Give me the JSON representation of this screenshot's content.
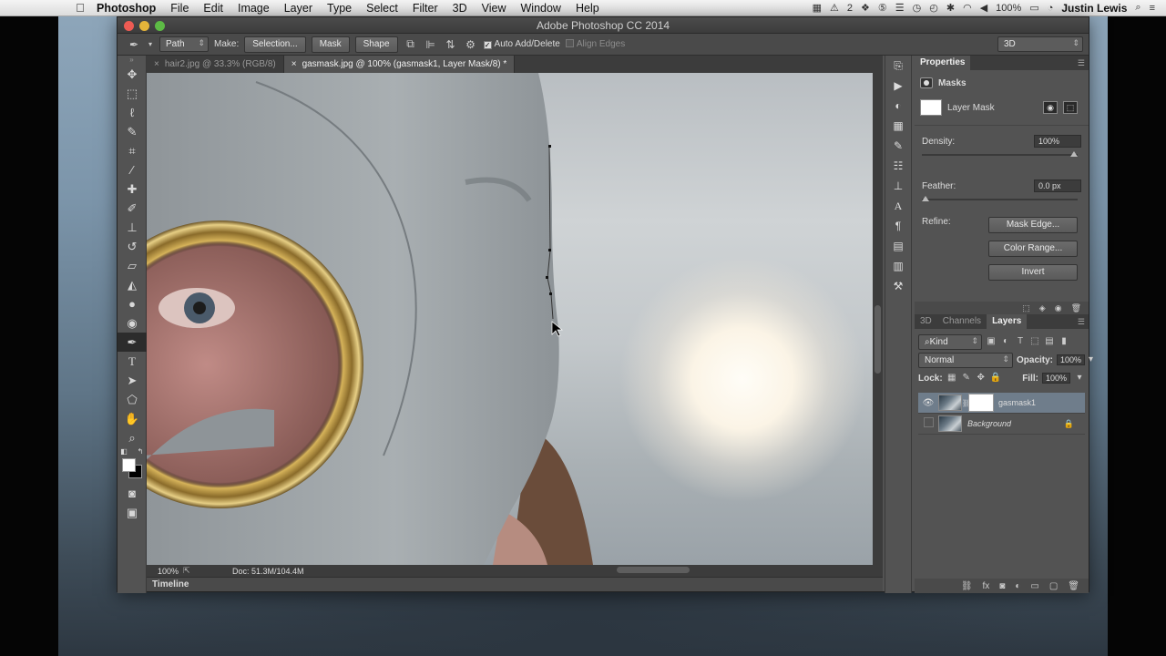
{
  "menubar": {
    "app": "Photoshop",
    "items": [
      "File",
      "Edit",
      "Image",
      "Layer",
      "Type",
      "Select",
      "Filter",
      "3D",
      "View",
      "Window",
      "Help"
    ],
    "status_badge": "2",
    "battery": "100%",
    "user": "Justin Lewis"
  },
  "window": {
    "title": "Adobe Photoshop CC 2014"
  },
  "options": {
    "mode": "Path",
    "make_label": "Make:",
    "selection": "Selection...",
    "mask": "Mask",
    "shape": "Shape",
    "auto_add_delete": "Auto Add/Delete",
    "align_edges": "Align Edges",
    "workspace": "3D"
  },
  "tabs": [
    {
      "label": "hair2.jpg @ 33.3% (RGB/8)"
    },
    {
      "label": "gasmask.jpg @ 100% (gasmask1, Layer Mask/8) *"
    }
  ],
  "status": {
    "zoom": "100%",
    "doc": "Doc: 51.3M/104.4M"
  },
  "timeline": {
    "label": "Timeline"
  },
  "properties": {
    "tab": "Properties",
    "section": "Masks",
    "layer_mask": "Layer Mask",
    "density_label": "Density:",
    "density": "100%",
    "density_fraction": 1.0,
    "feather_label": "Feather:",
    "feather": "0.0 px",
    "refine_label": "Refine:",
    "mask_edge": "Mask Edge...",
    "color_range": "Color Range...",
    "invert": "Invert"
  },
  "layers_panel": {
    "tabs": [
      "3D",
      "Channels",
      "Layers"
    ],
    "filter": "Kind",
    "blend_mode": "Normal",
    "opacity_label": "Opacity:",
    "opacity": "100%",
    "lock_label": "Lock:",
    "fill_label": "Fill:",
    "fill": "100%",
    "layers": [
      {
        "name": "gasmask1"
      },
      {
        "name": "Background"
      }
    ]
  },
  "colors": {
    "foreground": "#ffffff",
    "background": "#000000",
    "selected_layer": "#6f7d8b"
  }
}
